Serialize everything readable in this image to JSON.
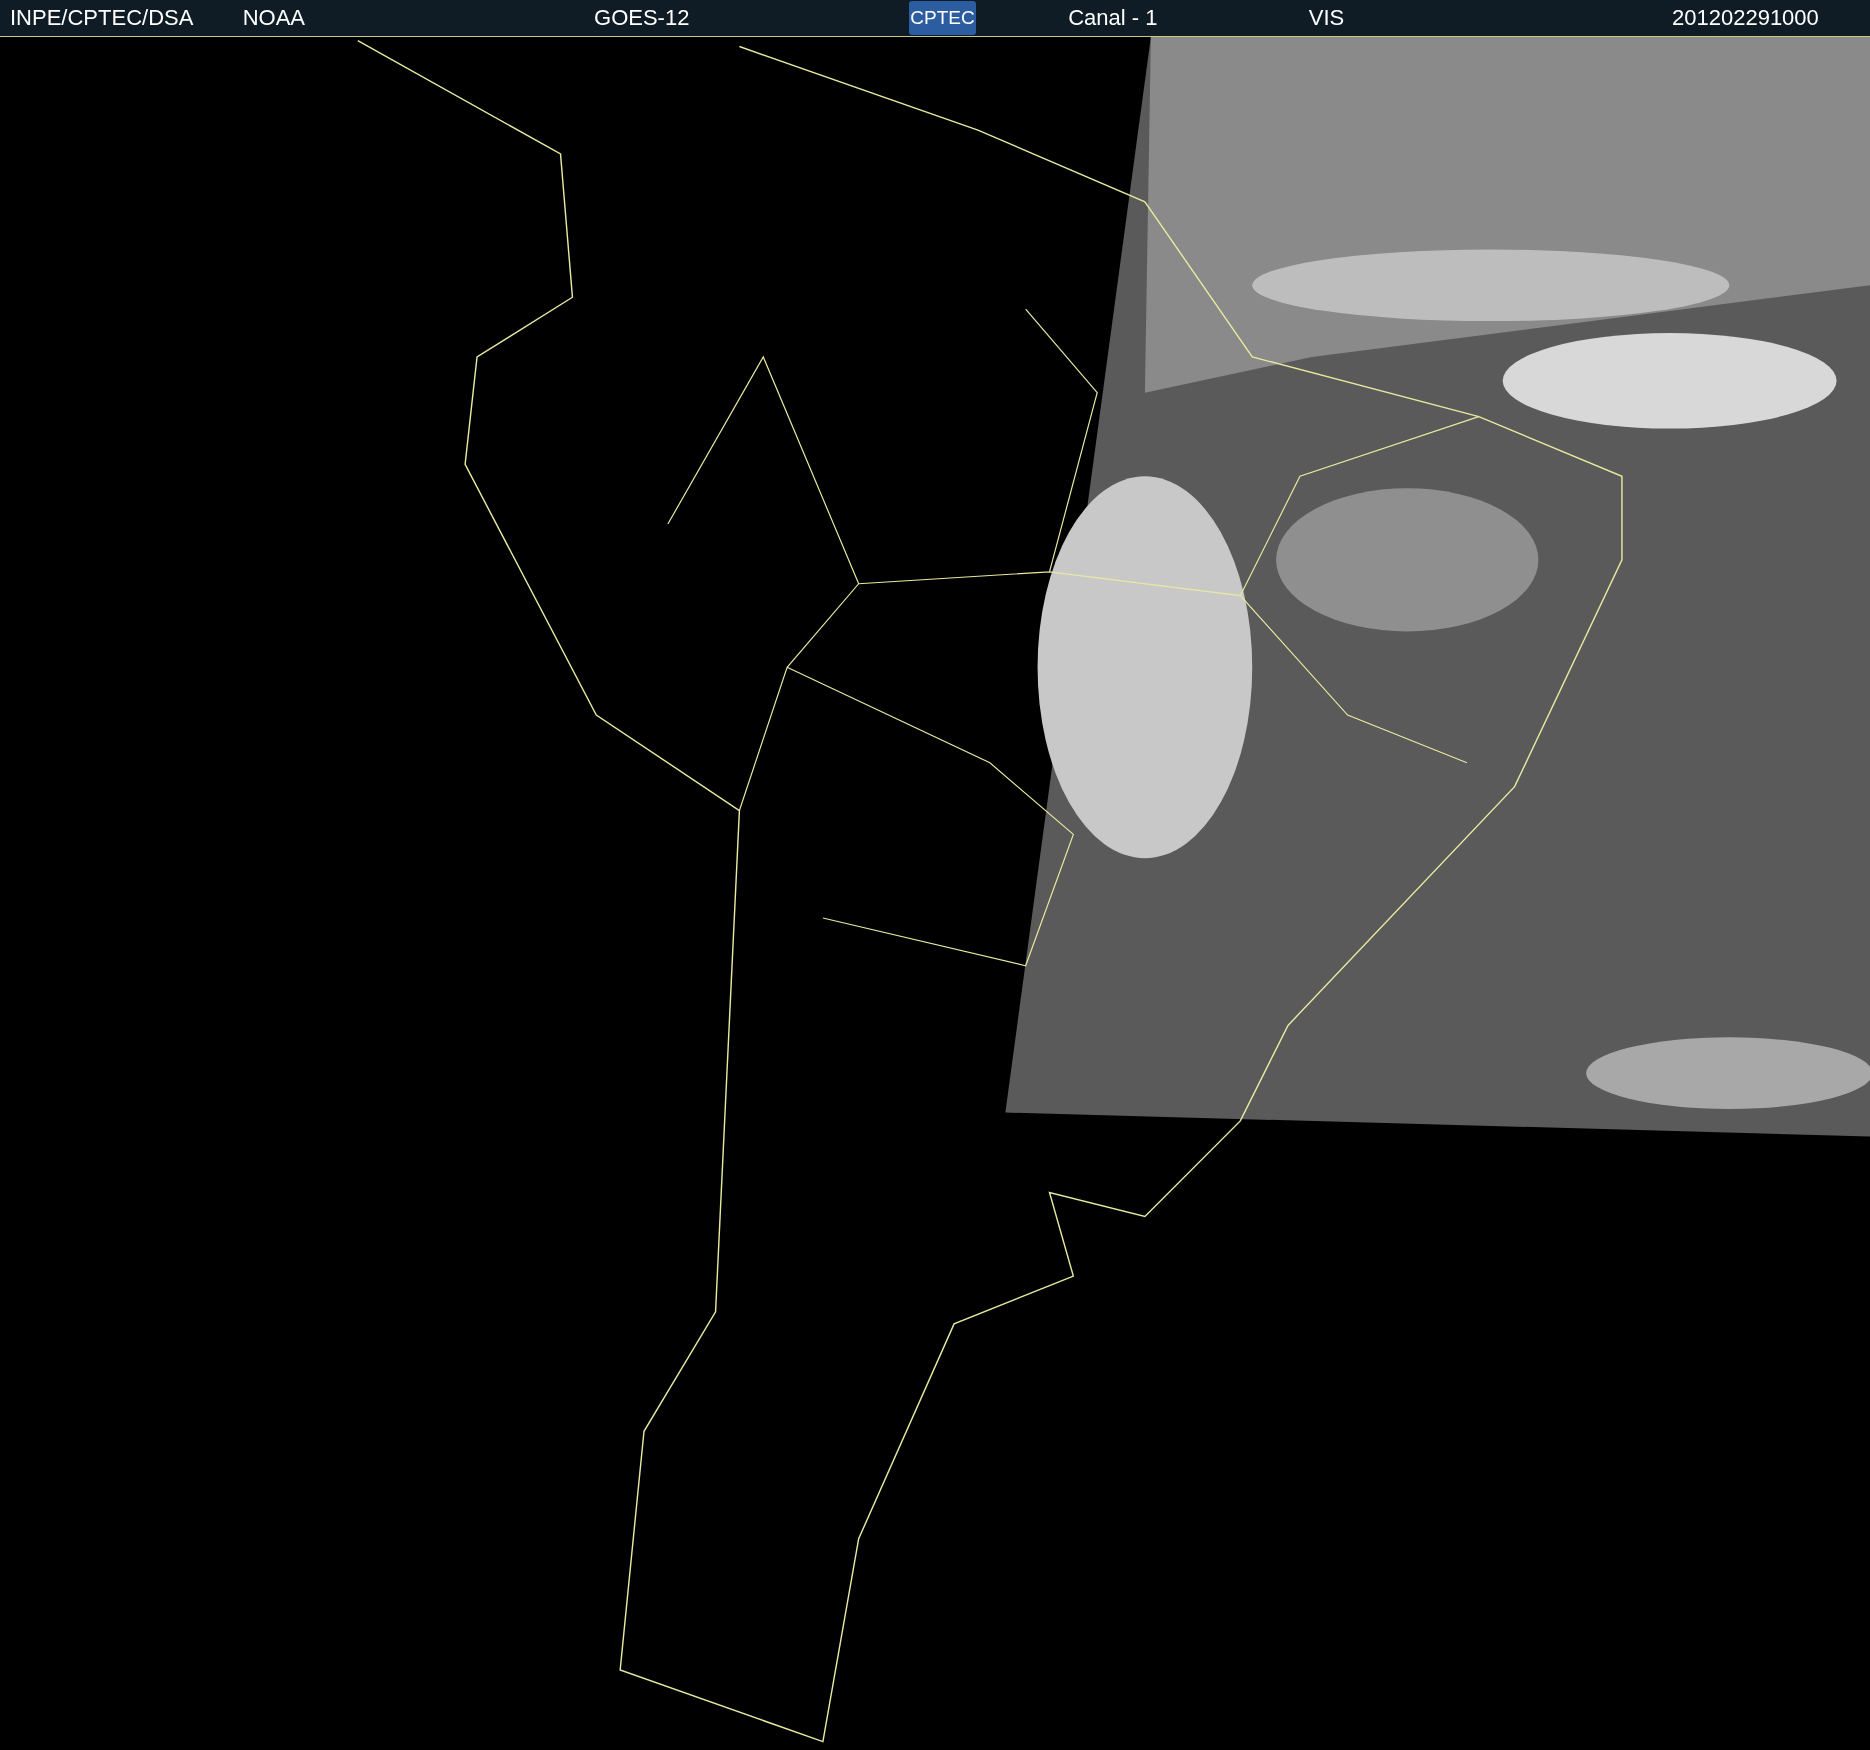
{
  "header": {
    "items": [
      {
        "kind": "text",
        "text": "INPE/CPTEC/DSA"
      },
      {
        "kind": "text",
        "text": "NOAA"
      },
      {
        "kind": "text",
        "text": "GOES-12"
      },
      {
        "kind": "logo",
        "text": "CPTEC"
      },
      {
        "kind": "text",
        "text": "Canal - 1"
      },
      {
        "kind": "text",
        "text": "VIS"
      },
      {
        "kind": "text",
        "text": "201202291000"
      }
    ]
  }
}
